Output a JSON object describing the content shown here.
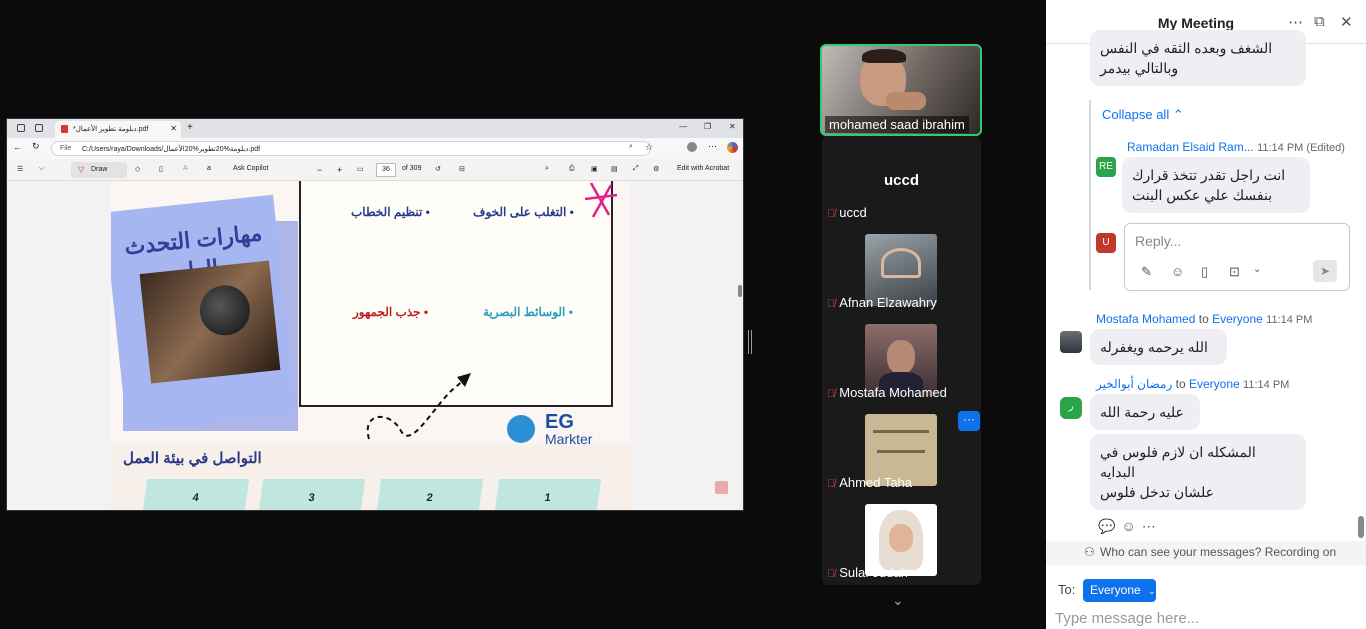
{
  "pdf_viewer": {
    "tab_title": "*دبلومة تطوير الأعمال.pdf",
    "address_prefix": "File",
    "address": "C:/Users/raya/Downloads/دبلومة%20تطوير%20الأعمال.pdf",
    "toolbar": {
      "draw": "Draw",
      "ask_copilot": "Ask Copilot",
      "page_current": "36",
      "page_total": "of 309",
      "edit_acrobat": "Edit with Acrobat"
    },
    "page": {
      "card_title": "مهارات التحدث العام",
      "items": {
        "fear": "• التغلب على الخوف",
        "speech": "• تنظيم الخطاب",
        "visual": "• الوسائط البصرية",
        "audience": "• جذب الجمهور"
      },
      "bottom_title": "التواصل في بيئة العمل",
      "clip_numbers": [
        "4",
        "3",
        "2",
        "1"
      ],
      "logo_top": "EG",
      "logo_bottom": "Markter"
    }
  },
  "meeting": {
    "self_name": "mohamed saad ibrahim",
    "gallery_title": "uccd",
    "participants": [
      {
        "name": "uccd"
      },
      {
        "name": "Afnan Elzawahry"
      },
      {
        "name": "Mostafa Mohamed"
      },
      {
        "name": "Ahmed Taha"
      },
      {
        "name": "Sulaf Judah"
      }
    ],
    "more_label": "···"
  },
  "chat": {
    "title": "My Meeting",
    "messages": {
      "top_bubble": "الشغف وبعده الثقه في النفس\nوبالتالي بيدمر",
      "collapse": "Collapse all",
      "ramadan": {
        "name": "Ramadan Elsaid Ram...",
        "time": "11:14 PM (Edited)",
        "initials": "RE",
        "text": "انت راجل تقدر تتخذ قرارك\nبنفسك علي عكس البنت"
      },
      "reply_avatar": "U",
      "reply_placeholder": "Reply...",
      "mostafa": {
        "name": "Mostafa Mohamed",
        "to": "to",
        "target": "Everyone",
        "time": "11:14 PM",
        "text": "الله يرحمه ويغفرله"
      },
      "ramadan2": {
        "name": "رمضان أبوالخير",
        "to": "to",
        "target": "Everyone",
        "time": "11:14 PM",
        "initials": "ر",
        "text1": "عليه رحمة الله",
        "text2": "المشكله ان لازم فلوس في\nالبدايه\nعلشان تدخل فلوس"
      }
    },
    "visibility": "Who can see your messages? Recording on",
    "to_label": "To:",
    "to_value": "Everyone",
    "input_placeholder": "Type message here..."
  }
}
